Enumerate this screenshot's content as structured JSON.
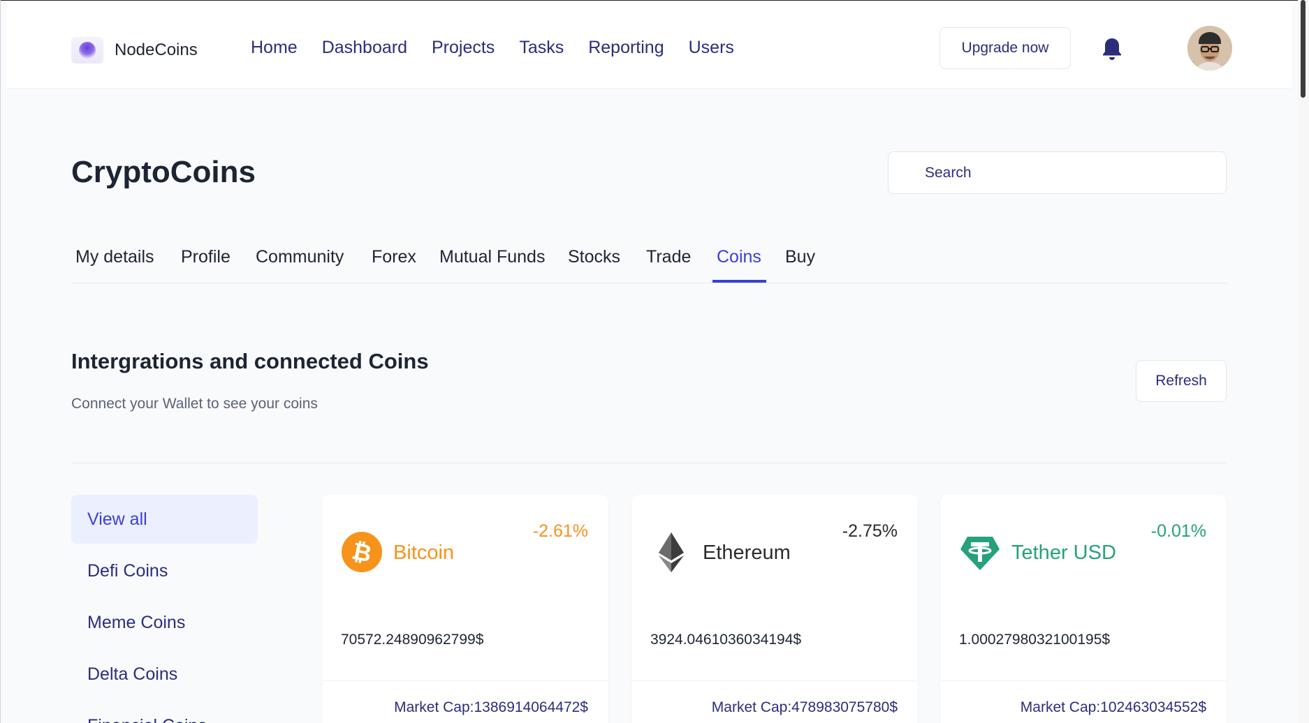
{
  "header": {
    "brand": "NodeCoins",
    "nav": [
      "Home",
      "Dashboard",
      "Projects",
      "Tasks",
      "Reporting",
      "Users"
    ],
    "upgrade_label": "Upgrade now",
    "bell_icon": "bell-icon",
    "avatar_icon": "avatar"
  },
  "page": {
    "title": "CryptoCoins",
    "search_placeholder": "Search"
  },
  "tabs": [
    "My details",
    "Profile",
    "Community",
    "Forex",
    "Mutual Funds",
    "Stocks",
    "Trade",
    "Coins",
    "Buy"
  ],
  "active_tab": "Coins",
  "section": {
    "title": "Intergrations and connected Coins",
    "subtitle": "Connect your Wallet to see your coins",
    "refresh_label": "Refresh"
  },
  "filters": [
    "View all",
    "Defi Coins",
    "Meme Coins",
    "Delta Coins",
    "Financial Coins"
  ],
  "coins": [
    {
      "name": "Bitcoin",
      "change": "-2.61%",
      "price": "70572.24890962799$",
      "market_cap": "Market Cap:1386914064472$",
      "color": "#f7931a",
      "icon": "bitcoin-icon"
    },
    {
      "name": "Ethereum",
      "change": "-2.75%",
      "price": "3924.0461036034194$",
      "market_cap": "Market Cap:478983075780$",
      "color": "#2b2b2b",
      "icon": "ethereum-icon"
    },
    {
      "name": "Tether USD",
      "change": "-0.01%",
      "price": "1.0002798032100195$",
      "market_cap": "Market Cap:102463034552$",
      "color": "#26a17b",
      "icon": "tether-icon"
    }
  ],
  "colors": {
    "accent": "#3a3fd6",
    "nav_text": "#2b2d7c",
    "background": "#f9fafc"
  }
}
